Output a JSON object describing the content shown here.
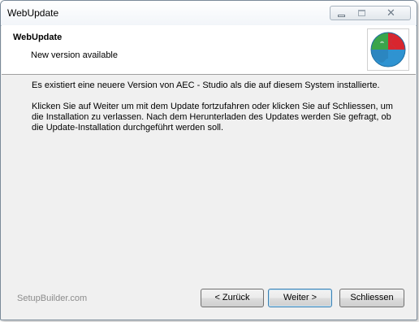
{
  "window": {
    "title": "WebUpdate"
  },
  "header": {
    "title": "WebUpdate",
    "subtitle": "New version available",
    "logo_icon": "puzzle-globe-icon"
  },
  "body": {
    "paragraph1": "Es existiert eine neuere Version von AEC - Studio als die auf diesem System installierte.",
    "paragraph2": "Klicken Sie auf Weiter um mit dem Update fortzufahren oder klicken Sie auf Schliessen, um die Installation zu verlassen. Nach dem Herunterladen des Updates werden Sie gefragt, ob die Update-Installation durchgeführt werden soll."
  },
  "footer": {
    "brand": "SetupBuilder.com",
    "back_label": "< Zurück",
    "next_label": "Weiter >",
    "close_label": "Schliessen"
  },
  "colors": {
    "dialog_background": "#f0f0f0",
    "header_background": "#ffffff",
    "logo_red": "#d8262e",
    "logo_green": "#3aa54a",
    "logo_blue": "#2f93d1"
  }
}
